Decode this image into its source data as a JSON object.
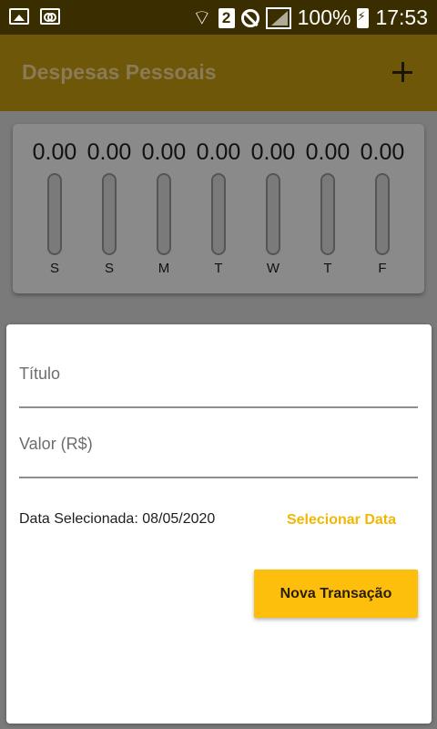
{
  "status_bar": {
    "sim_badge": "2",
    "battery": "100%",
    "time": "17:53"
  },
  "app_bar": {
    "title": "Despesas Pessoais",
    "add_icon": "plus-icon"
  },
  "chart": {
    "bars": [
      {
        "day": "S",
        "amount": "0.00",
        "fill": 0
      },
      {
        "day": "S",
        "amount": "0.00",
        "fill": 0
      },
      {
        "day": "M",
        "amount": "0.00",
        "fill": 0
      },
      {
        "day": "T",
        "amount": "0.00",
        "fill": 0
      },
      {
        "day": "W",
        "amount": "0.00",
        "fill": 0
      },
      {
        "day": "T",
        "amount": "0.00",
        "fill": 0
      },
      {
        "day": "F",
        "amount": "0.00",
        "fill": 0
      }
    ]
  },
  "form": {
    "title_label": "Título",
    "value_label": "Valor (R$)",
    "selected_date": "Data Selecionada: 08/05/2020",
    "select_date_label": "Selecionar Data",
    "submit_label": "Nova Transação"
  },
  "colors": {
    "accent": "#fdbf0b",
    "app_bar": "#6e5709",
    "status_bar": "#3a2e00"
  }
}
